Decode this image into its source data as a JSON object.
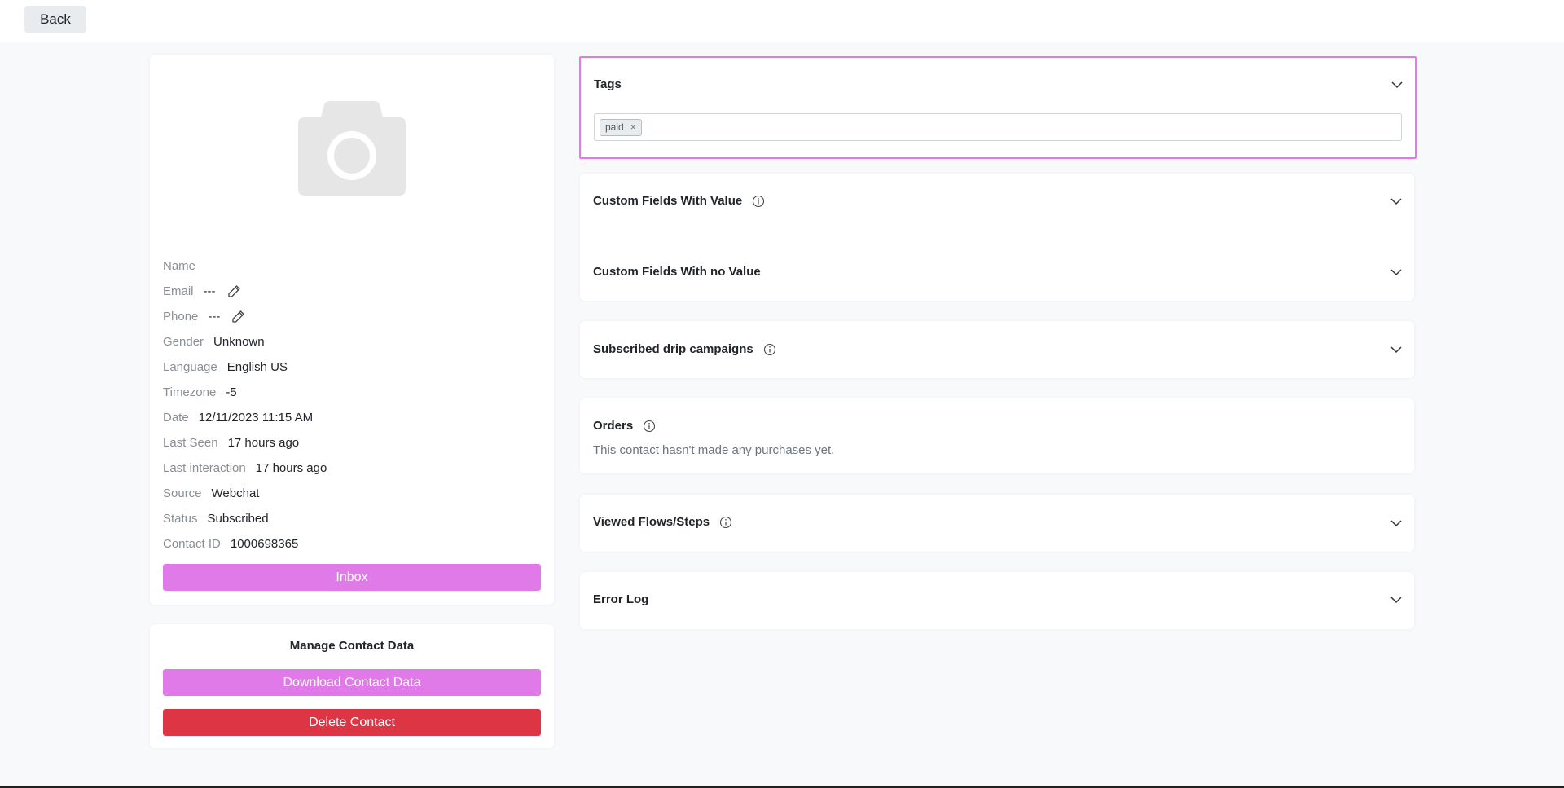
{
  "header": {
    "back_label": "Back"
  },
  "profile": {
    "avatar_icon": "camera-icon",
    "fields": [
      {
        "label": "Name",
        "value": ""
      },
      {
        "label": "Email",
        "value": "---"
      },
      {
        "label": "Phone",
        "value": "---"
      },
      {
        "label": "Gender",
        "value": "Unknown"
      },
      {
        "label": "Language",
        "value": "English US"
      },
      {
        "label": "Timezone",
        "value": "-5"
      },
      {
        "label": "Date",
        "value": "12/11/2023 11:15 AM"
      },
      {
        "label": "Last Seen",
        "value": "17 hours ago"
      },
      {
        "label": "Last interaction",
        "value": "17 hours ago"
      },
      {
        "label": "Source",
        "value": "Webchat"
      },
      {
        "label": "Status",
        "value": "Subscribed"
      },
      {
        "label": "Contact ID",
        "value": "1000698365"
      }
    ],
    "inbox_label": "Inbox"
  },
  "manage": {
    "title": "Manage Contact Data",
    "download_label": "Download Contact Data",
    "delete_label": "Delete Contact"
  },
  "panels": {
    "tags": {
      "title": "Tags",
      "chips": [
        "paid"
      ],
      "remove_symbol": "×"
    },
    "custom_with_value": {
      "title": "Custom Fields With Value"
    },
    "custom_no_value": {
      "title": "Custom Fields With no Value"
    },
    "drip": {
      "title": "Subscribed drip campaigns"
    },
    "orders": {
      "title": "Orders",
      "empty_text": "This contact hasn't made any purchases yet."
    },
    "viewed_flows": {
      "title": "Viewed Flows/Steps"
    },
    "error_log": {
      "title": "Error Log"
    }
  },
  "colors": {
    "accent": "#e07ae8",
    "danger": "#de3545",
    "background": "#f8f9fa"
  }
}
